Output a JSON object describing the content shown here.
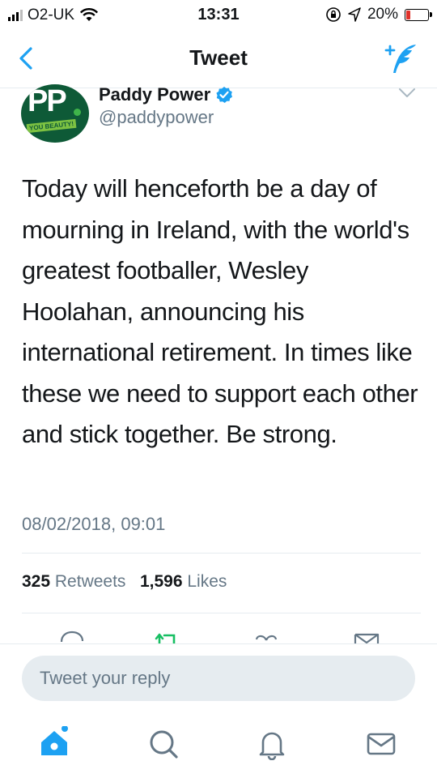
{
  "status_bar": {
    "carrier": "O2-UK",
    "time": "13:31",
    "battery": "20%"
  },
  "header": {
    "title": "Tweet"
  },
  "tweet": {
    "author_name": "Paddy Power",
    "handle": "@paddypower",
    "avatar_text": "PP",
    "avatar_badge": "YOU BEAUTY!",
    "text": "Today will henceforth be a day of mourning in Ireland, with the world's greatest footballer, Wesley Hoolahan, announcing his international retirement. In times like these we need to support each other and stick together. Be strong.",
    "timestamp": "08/02/2018, 09:01",
    "retweets_count": "325",
    "retweets_label": "Retweets",
    "likes_count": "1,596",
    "likes_label": "Likes"
  },
  "reply": {
    "placeholder": "Tweet your reply"
  },
  "tabbar": {
    "items": [
      "home-icon",
      "search-icon",
      "notifications-icon",
      "messages-icon"
    ]
  },
  "colors": {
    "accent": "#1da1f2",
    "muted": "#657786",
    "avatar_green": "#0e5a37",
    "retweet_green": "#17bf63"
  }
}
